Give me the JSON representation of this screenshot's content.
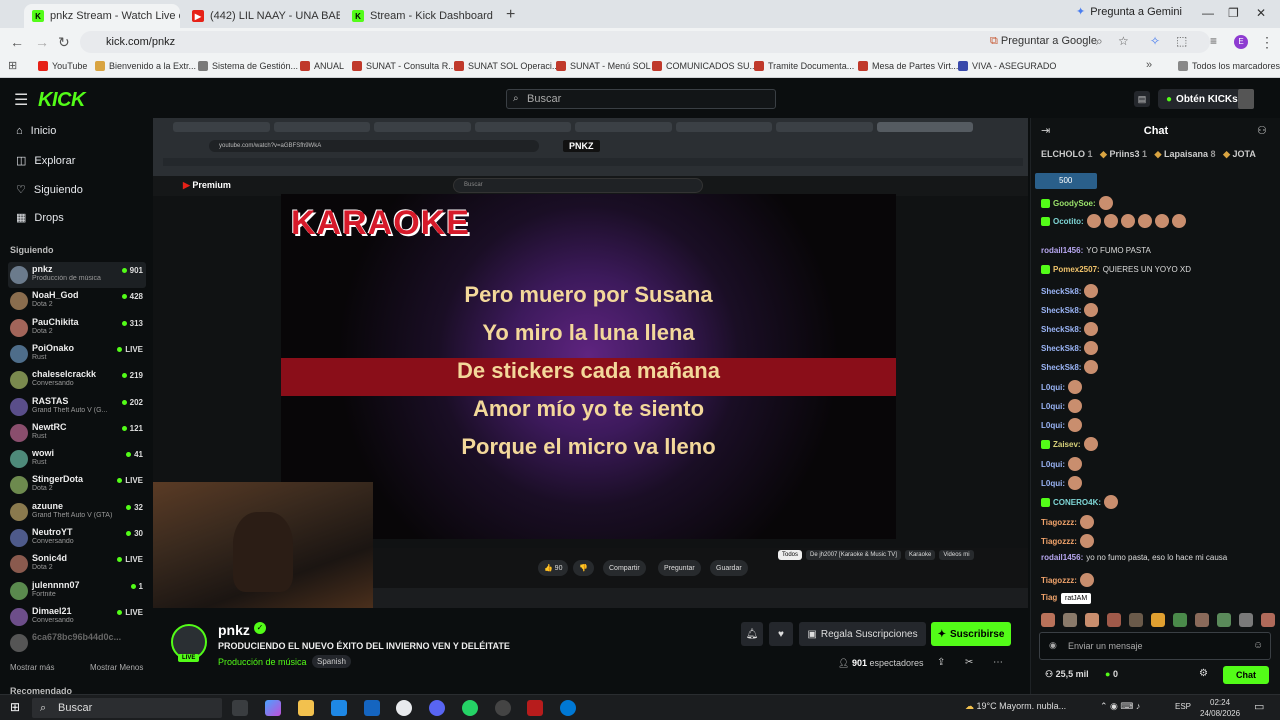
{
  "browser": {
    "tabs": [
      {
        "label": "pnkz Stream - Watch Live o",
        "active": true
      },
      {
        "label": "(442) LIL NAAY - UNA BABY E",
        "active": false
      },
      {
        "label": "Stream - Kick Dashboard",
        "active": false
      }
    ],
    "gemini_label": "Pregunta a Gemini",
    "url": "kick.com/pnkz",
    "ask_google": "Preguntar a Google",
    "bookmarks": [
      "YouTube",
      "Bienvenido a la Extr...",
      "Sistema de Gestión...",
      "ANUAL",
      "SUNAT - Consulta R...",
      "SUNAT SOL Operaci...",
      "SUNAT - Menú SOL",
      "COMUNICADOS SU...",
      "Tramite Documenta...",
      "Mesa de Partes Virt...",
      "VIVA - ASEGURADO"
    ],
    "all_bookmarks": "Todos los marcadores"
  },
  "kick": {
    "search_placeholder": "Buscar",
    "kicks_button": "Obtén KICKs",
    "nav": [
      {
        "label": "Inicio",
        "icon": "home-icon"
      },
      {
        "label": "Explorar",
        "icon": "compass-icon"
      },
      {
        "label": "Siguiendo",
        "icon": "heart-icon"
      },
      {
        "label": "Drops",
        "icon": "drops-icon"
      }
    ],
    "following_label": "Siguiendo",
    "following": [
      {
        "name": "pnkz",
        "category": "Producción de música",
        "count": "901"
      },
      {
        "name": "NoaH_God",
        "category": "Dota 2",
        "count": "428"
      },
      {
        "name": "PauChikita",
        "category": "Dota 2",
        "count": "313"
      },
      {
        "name": "PoiOnako",
        "category": "Rust",
        "count": "LIVE"
      },
      {
        "name": "chaleselcrackk",
        "category": "Conversando",
        "count": "219"
      },
      {
        "name": "RASTAS",
        "category": "Grand Theft Auto V (G...",
        "count": "202"
      },
      {
        "name": "NewtRC",
        "category": "Rust",
        "count": "121"
      },
      {
        "name": "wowi",
        "category": "Rust",
        "count": "41"
      },
      {
        "name": "StingerDota",
        "category": "Dota 2",
        "count": "LIVE"
      },
      {
        "name": "azuune",
        "category": "Grand Theft Auto V (GTA)",
        "count": "32"
      },
      {
        "name": "NeutroYT",
        "category": "Conversando",
        "count": "30"
      },
      {
        "name": "Sonic4d",
        "category": "Dota 2",
        "count": "LIVE"
      },
      {
        "name": "julennnn07",
        "category": "Fortnite",
        "count": "1"
      },
      {
        "name": "Dimael21",
        "category": "Conversando",
        "count": "LIVE"
      },
      {
        "name": "6ca678bc96b44d0c...",
        "category": "",
        "count": ""
      }
    ],
    "show_more": "Mostrar más",
    "show_less": "Mostrar Menos",
    "recommended": "Recomendado"
  },
  "player": {
    "inner_title": "PNKZ",
    "inner_url": "youtube.com/watch?v=aGBFSfh9WkA",
    "yt_search": "Buscar",
    "karaoke_title": "KARAOKE",
    "lyrics": [
      "Pero muero por Susana",
      "Yo miro la luna llena",
      "De stickers cada mañana",
      "Amor mío yo te siento",
      "Porque el micro va lleno"
    ],
    "yt_buttons": [
      "Compartir",
      "Preguntar",
      "Guardar"
    ],
    "yt_likes": "90",
    "yt_chips": [
      "Todos",
      "De jh2007 [Karaoke & Music TV]",
      "Karaoke",
      "Videos mi"
    ]
  },
  "stream": {
    "channel": "pnkz",
    "live": "LIVE",
    "title": "PRODUCIENDO EL NUEVO ÉXITO DEL INVIERNO VEN Y DELÉITATE",
    "category": "Producción de música",
    "language": "Spanish",
    "gift_button": "Regala Suscripciones",
    "subscribe_button": "Suscribirse",
    "viewers": "901",
    "viewers_label": "espectadores"
  },
  "chat": {
    "title": "Chat",
    "gifters": [
      {
        "name": "ELCHOLO",
        "count": "1"
      },
      {
        "name": "Priins3",
        "count": "1"
      },
      {
        "name": "Lapaisana",
        "count": "8"
      },
      {
        "name": "JOTA",
        "count": ""
      }
    ],
    "goal": "500",
    "messages": [
      {
        "user": "GoodySoe:",
        "text": "",
        "color": "#9be36b"
      },
      {
        "user": "Ocotito:",
        "text": "",
        "color": "#7fd6d6"
      },
      {
        "user": "rodail1456:",
        "text": "YO FUMO PASTA",
        "color": "#b7a7f0"
      },
      {
        "user": "Pomex2507:",
        "text": "QUIERES UN YOYO XD",
        "color": "#f0c36b"
      },
      {
        "user": "SheckSk8:",
        "text": "",
        "color": "#9ab4f5"
      },
      {
        "user": "SheckSk8:",
        "text": "",
        "color": "#9ab4f5"
      },
      {
        "user": "SheckSk8:",
        "text": "",
        "color": "#9ab4f5"
      },
      {
        "user": "SheckSk8:",
        "text": "",
        "color": "#9ab4f5"
      },
      {
        "user": "SheckSk8:",
        "text": "",
        "color": "#9ab4f5"
      },
      {
        "user": "L0qui:",
        "text": "",
        "color": "#9ab4f5"
      },
      {
        "user": "L0qui:",
        "text": "",
        "color": "#9ab4f5"
      },
      {
        "user": "L0qui:",
        "text": "",
        "color": "#9ab4f5"
      },
      {
        "user": "Zaisev:",
        "text": "",
        "color": "#d7d07a"
      },
      {
        "user": "L0qui:",
        "text": "",
        "color": "#9ab4f5"
      },
      {
        "user": "L0qui:",
        "text": "",
        "color": "#9ab4f5"
      },
      {
        "user": "CONERO4K:",
        "text": "",
        "color": "#7fd6d6"
      },
      {
        "user": "Tiagozzz:",
        "text": "",
        "color": "#f0a36b"
      },
      {
        "user": "Tiagozzz:",
        "text": "",
        "color": "#f0a36b"
      },
      {
        "user": "rodail1456:",
        "text": "yo no fumo pasta, eso lo hace mi causa",
        "color": "#b7a7f0"
      },
      {
        "user": "Tiagozzz:",
        "text": "",
        "color": "#f0a36b"
      }
    ],
    "partial_user": "Tiag",
    "tooltip": "ratJAM",
    "input_placeholder": "Enviar un mensaje",
    "followers": "25,5 mil",
    "kicks": "0",
    "send": "Chat"
  },
  "taskbar": {
    "search": "Buscar",
    "weather": "19°C  Mayorm. nubla...",
    "lang": "ESP",
    "time": "02:24",
    "date": "24/08/2026"
  },
  "colors": {
    "kick_green": "#53fc18",
    "background": "#0b0e0f"
  }
}
